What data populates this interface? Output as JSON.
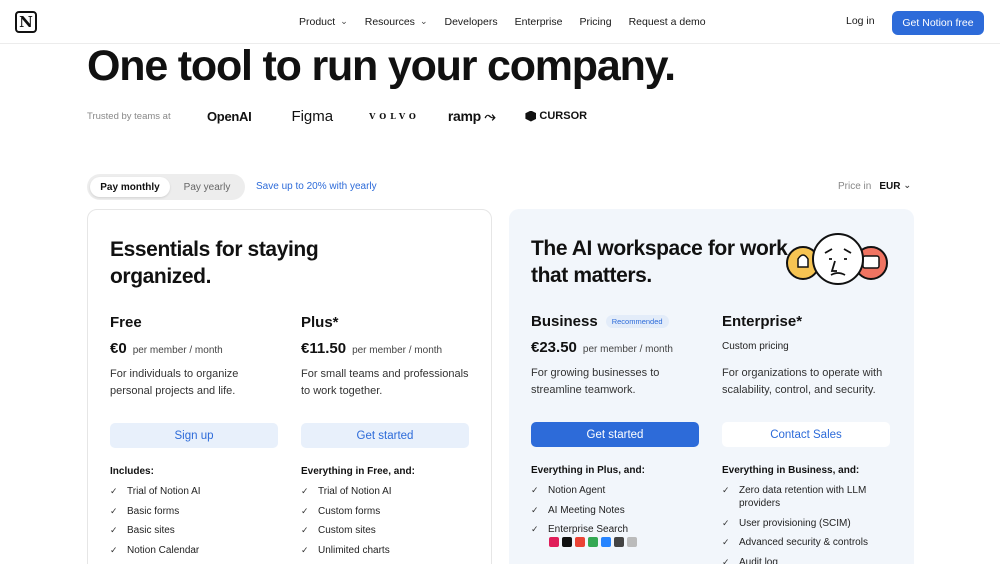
{
  "nav": {
    "logo_letter": "N",
    "links": [
      {
        "label": "Product",
        "dropdown": true
      },
      {
        "label": "Resources",
        "dropdown": true
      },
      {
        "label": "Developers",
        "dropdown": false
      },
      {
        "label": "Enterprise",
        "dropdown": false
      },
      {
        "label": "Pricing",
        "dropdown": false
      },
      {
        "label": "Request a demo",
        "dropdown": false
      }
    ],
    "login": "Log in",
    "cta": "Get Notion free"
  },
  "hero": {
    "title": "One tool to run your company.",
    "trusted_label": "Trusted by teams at",
    "brands": [
      "OpenAI",
      "Figma",
      "VOLVO",
      "ramp",
      "CURSOR"
    ]
  },
  "billing": {
    "monthly": "Pay monthly",
    "yearly": "Pay yearly",
    "selected": "monthly",
    "save_note": "Save up to 20% with yearly",
    "price_in_label": "Price in",
    "currency": "EUR"
  },
  "left_card": {
    "title": "Essentials for staying organized.",
    "plans": [
      {
        "name": "Free",
        "price": "€0",
        "per": "per member / month",
        "desc": "For individuals to organize personal projects and life.",
        "button": "Sign up",
        "features_head": "Includes:",
        "features": [
          "Trial of Notion AI",
          "Basic forms",
          "Basic sites",
          "Notion Calendar"
        ]
      },
      {
        "name": "Plus*",
        "price": "€11.50",
        "per": "per member / month",
        "desc": "For small teams and professionals to work together.",
        "button": "Get started",
        "features_head": "Everything in Free, and:",
        "features": [
          "Trial of Notion AI",
          "Custom forms",
          "Custom sites",
          "Unlimited charts"
        ]
      }
    ]
  },
  "right_card": {
    "title": "The AI workspace for work that matters.",
    "plans": [
      {
        "name": "Business",
        "badge": "Recommended",
        "price": "€23.50",
        "per": "per member / month",
        "desc": "For growing businesses to streamline teamwork.",
        "button": "Get started",
        "features_head": "Everything in Plus, and:",
        "features": [
          "Notion Agent",
          "AI Meeting Notes",
          "Enterprise Search"
        ]
      },
      {
        "name": "Enterprise*",
        "custom": "Custom pricing",
        "desc": "For organizations to operate with scalability, control, and security.",
        "button": "Contact Sales",
        "features_head": "Everything in Business, and:",
        "features": [
          "Zero data retention with LLM providers",
          "User provisioning (SCIM)",
          "Advanced security & controls",
          "Audit log"
        ]
      }
    ]
  },
  "colors": {
    "accent": "#2d6bd9",
    "soft_button": "#e8f0fb",
    "right_card_bg": "#f2f6fb"
  }
}
